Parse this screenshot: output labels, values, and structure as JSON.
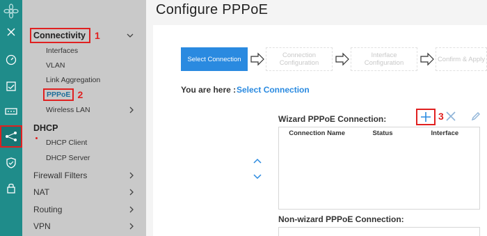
{
  "rail": {
    "icons": [
      "logo-icon",
      "close-icon",
      "dashboard-icon",
      "inbox-icon",
      "device-icon",
      "network-icon",
      "shield-icon",
      "lock-icon"
    ]
  },
  "sidebar": {
    "connectivity": {
      "label": "Connectivity",
      "annotation": "1",
      "items": [
        "Interfaces",
        "VLAN",
        "Link Aggregation",
        "PPPoE",
        "Wireless LAN"
      ],
      "pppoe_annotation": "2"
    },
    "dhcp": {
      "label": "DHCP",
      "items": [
        "DHCP Client",
        "DHCP Server"
      ]
    },
    "menus": [
      "Firewall Filters",
      "NAT",
      "Routing",
      "VPN"
    ]
  },
  "main": {
    "title": "Configure PPPoE",
    "steps": [
      {
        "label": "Select Connection",
        "state": "current"
      },
      {
        "label": "Connection Configuration",
        "state": "future"
      },
      {
        "label": "Interface Configuration",
        "state": "future"
      },
      {
        "label": "Confirm & Apply",
        "state": "future"
      }
    ],
    "breadcrumb_label": "You are here :",
    "breadcrumb_current": "Select Connection",
    "wizard_title": "Wizard PPPoE Connection:",
    "add_annotation": "3",
    "columns": [
      "Connection Name",
      "Status",
      "Interface"
    ],
    "non_wizard_title": "Non-wizard PPPoE Connection:"
  },
  "colors": {
    "rail": "#1f8c8a",
    "sidebar": "#c9c9c9",
    "accent": "#2a8ae0",
    "annotation": "#e02020"
  }
}
